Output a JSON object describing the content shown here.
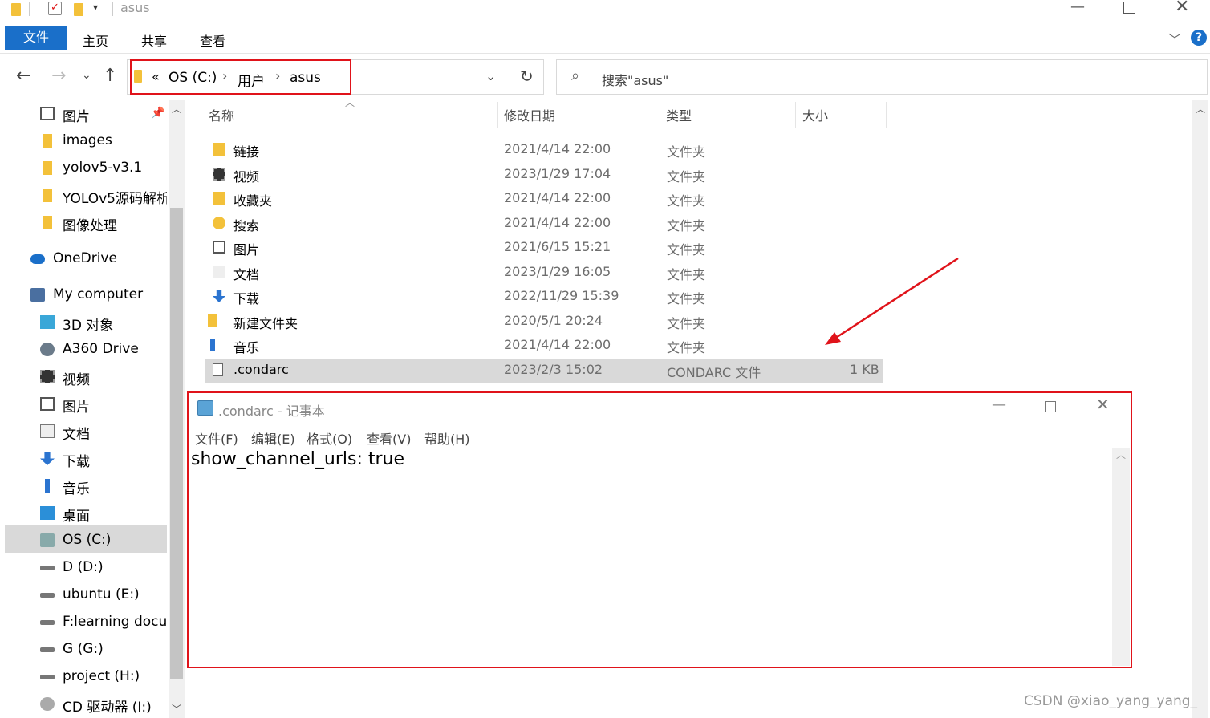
{
  "window": {
    "title": "asus"
  },
  "ribbon": {
    "tabs": [
      "文件",
      "主页",
      "共享",
      "查看"
    ]
  },
  "address": {
    "crumb_prefix": "«",
    "crumbs": [
      "OS (C:)",
      "用户",
      "asus"
    ],
    "search_placeholder": "搜索\"asus\""
  },
  "nav": {
    "items": [
      {
        "label": "图片",
        "icon": "picture-icon"
      },
      {
        "label": "images",
        "icon": "folder-icon"
      },
      {
        "label": "yolov5-v3.1",
        "icon": "folder-icon"
      },
      {
        "label": "YOLOv5源码解析",
        "icon": "folder-icon"
      },
      {
        "label": "图像处理",
        "icon": "folder-icon"
      },
      {
        "label": "OneDrive",
        "icon": "cloud-icon"
      },
      {
        "label": "My computer",
        "icon": "computer-icon"
      },
      {
        "label": "3D 对象",
        "icon": "cube-icon"
      },
      {
        "label": "A360 Drive",
        "icon": "drive-cloud-icon"
      },
      {
        "label": "视频",
        "icon": "film-icon"
      },
      {
        "label": "图片",
        "icon": "picture-icon"
      },
      {
        "label": "文档",
        "icon": "document-icon"
      },
      {
        "label": "下载",
        "icon": "download-icon"
      },
      {
        "label": "音乐",
        "icon": "music-icon"
      },
      {
        "label": "桌面",
        "icon": "desktop-icon"
      },
      {
        "label": "OS (C:)",
        "icon": "system-drive-icon"
      },
      {
        "label": "D (D:)",
        "icon": "drive-icon"
      },
      {
        "label": "ubuntu (E:)",
        "icon": "drive-icon"
      },
      {
        "label": "F:learning docu",
        "icon": "drive-icon"
      },
      {
        "label": "G (G:)",
        "icon": "drive-icon"
      },
      {
        "label": "project (H:)",
        "icon": "drive-icon"
      },
      {
        "label": "CD 驱动器 (I:)",
        "icon": "cd-drive-icon"
      }
    ]
  },
  "files": {
    "headers": [
      "名称",
      "修改日期",
      "类型",
      "大小"
    ],
    "rows": [
      {
        "name": "链接",
        "date": "2021/4/14 22:00",
        "type": "文件夹",
        "size": "",
        "icon": "link-folder-icon"
      },
      {
        "name": "视频",
        "date": "2023/1/29 17:04",
        "type": "文件夹",
        "size": "",
        "icon": "film-icon"
      },
      {
        "name": "收藏夹",
        "date": "2021/4/14 22:00",
        "type": "文件夹",
        "size": "",
        "icon": "star-folder-icon"
      },
      {
        "name": "搜索",
        "date": "2021/4/14 22:00",
        "type": "文件夹",
        "size": "",
        "icon": "search-folder-icon"
      },
      {
        "name": "图片",
        "date": "2021/6/15 15:21",
        "type": "文件夹",
        "size": "",
        "icon": "picture-icon"
      },
      {
        "name": "文档",
        "date": "2023/1/29 16:05",
        "type": "文件夹",
        "size": "",
        "icon": "document-icon"
      },
      {
        "name": "下载",
        "date": "2022/11/29 15:39",
        "type": "文件夹",
        "size": "",
        "icon": "download-icon"
      },
      {
        "name": "新建文件夹",
        "date": "2020/5/1 20:24",
        "type": "文件夹",
        "size": "",
        "icon": "folder-icon"
      },
      {
        "name": "音乐",
        "date": "2021/4/14 22:00",
        "type": "文件夹",
        "size": "",
        "icon": "music-icon"
      },
      {
        "name": ".condarc",
        "date": "2023/2/3 15:02",
        "type": "CONDARC 文件",
        "size": "1 KB",
        "icon": "file-icon"
      }
    ]
  },
  "notepad": {
    "title": ".condarc - 记事本",
    "menu": [
      "文件(F)",
      "编辑(E)",
      "格式(O)",
      "查看(V)",
      "帮助(H)"
    ],
    "content": "show_channel_urls: true"
  },
  "watermark": "CSDN @xiao_yang_yang_",
  "colors": {
    "accent": "#1a6fc9",
    "highlight": "#e0131a",
    "selected_row": "#d9d9d9",
    "folder": "#f3c13a"
  }
}
